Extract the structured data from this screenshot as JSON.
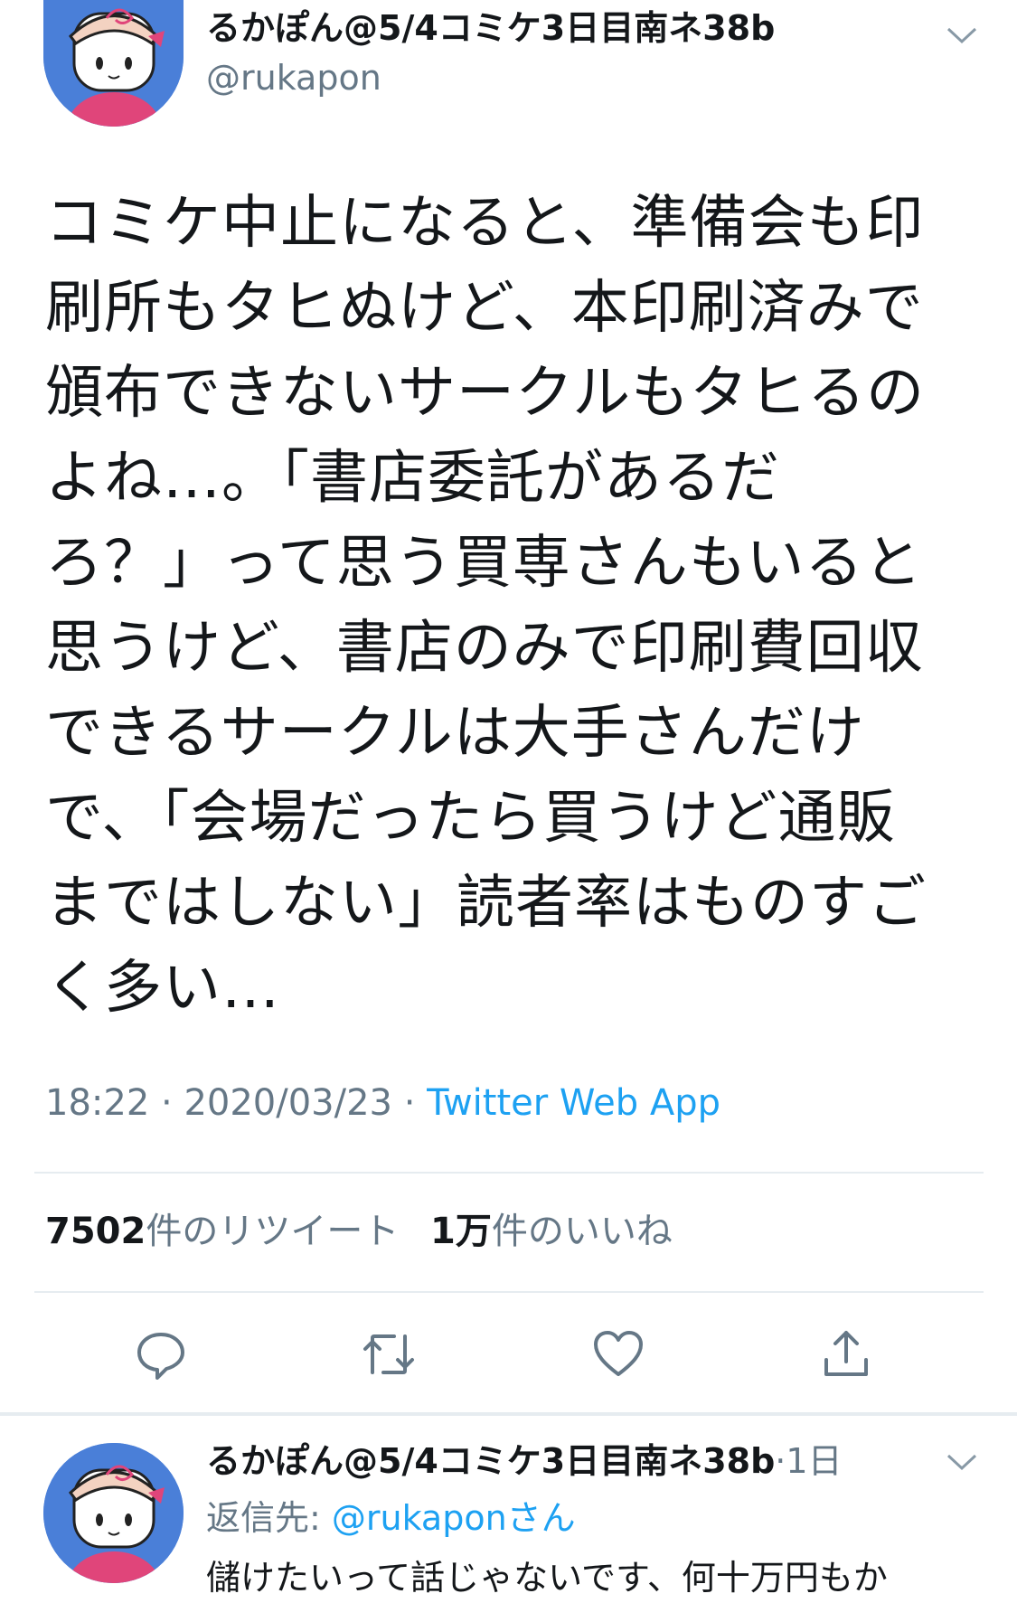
{
  "tweet": {
    "display_name": "るかぽん@5/4コミケ3日目南ネ38b",
    "handle": "@rukapon",
    "body_lines": [
      "コミケ中止になると、準備会も印",
      "刷所もタヒぬけど、本印刷済みで",
      "頒布できないサークルもタヒるの",
      "よね…。「書店委託があるだ",
      "ろ？」って思う買専さんもいると",
      "思うけど、書店のみで印刷費回収",
      "できるサークルは大手さんだけ",
      "で、「会場だったら買うけど通販",
      "まではしない」読者率はものすご",
      "く多い…"
    ],
    "time": "18:22",
    "date": "2020/03/23",
    "separator": "·",
    "source": "Twitter Web App",
    "retweet_count": "7502",
    "retweet_label": "件のリツイート",
    "like_count": "1万",
    "like_label": "件のいいね"
  },
  "actions": [
    "reply-icon",
    "retweet-icon",
    "like-icon",
    "share-icon"
  ],
  "reply": {
    "display_name": "るかぽん@5/4コミケ3日目南ネ38b",
    "separator": "·",
    "time_ago": "1日",
    "reply_prefix": "返信先: ",
    "reply_target": "@rukaponさん",
    "text": "儲けたいって話じゃないです、何十万円もか"
  },
  "colors": {
    "link": "#1da1f2",
    "secondary": "#657786",
    "text": "#14171a",
    "avatar_bg": "#4a7fd8",
    "avatar_shirt": "#e0457a"
  }
}
